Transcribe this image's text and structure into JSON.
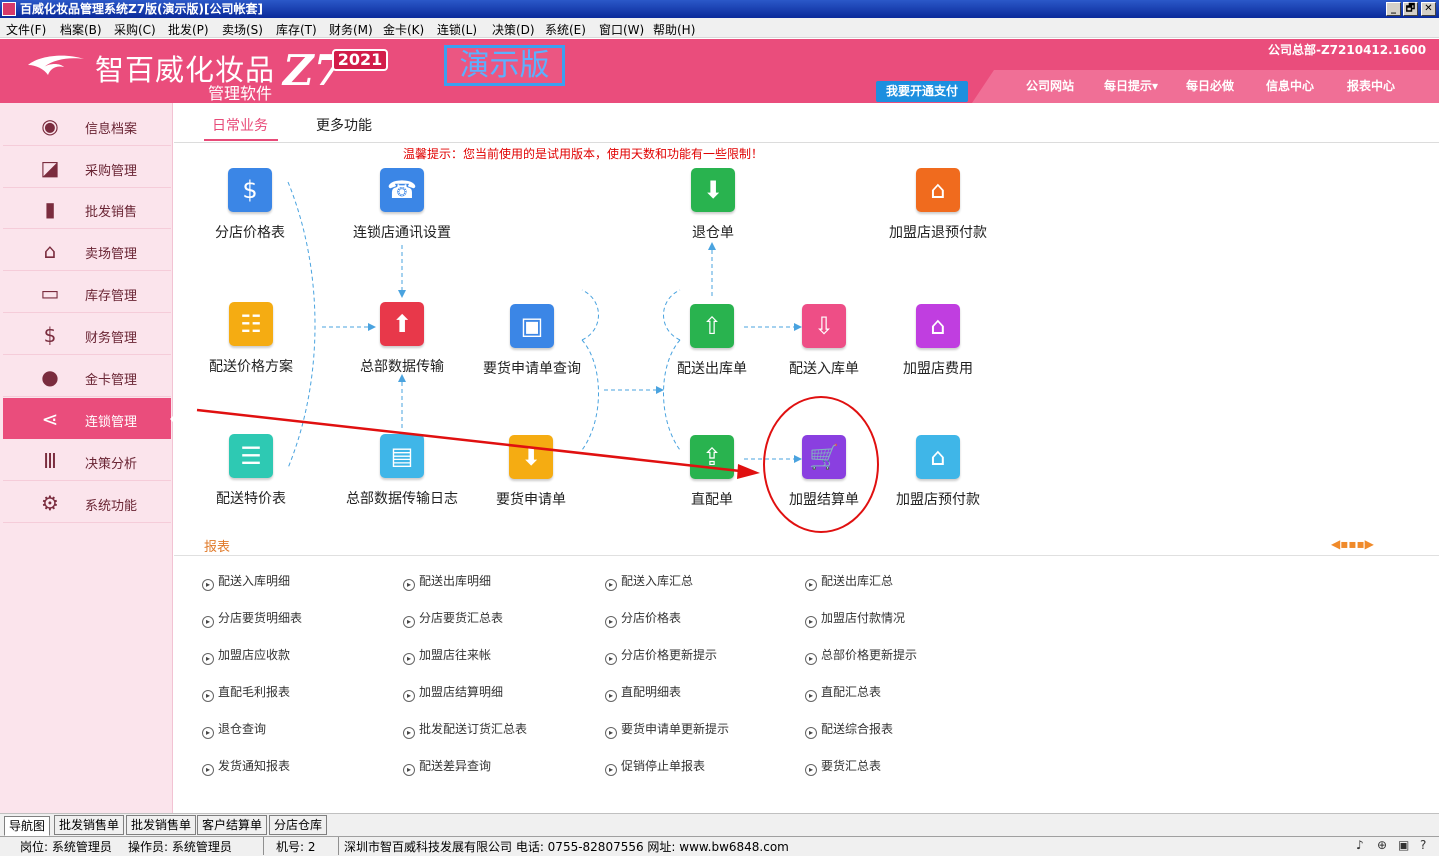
{
  "window": {
    "title": "百威化妆品管理系统Z7版(演示版)[公司帐套]",
    "controls": [
      "_",
      "🗗",
      "✕"
    ]
  },
  "menu": [
    "文件(F)",
    "档案(B)",
    "采购(C)",
    "批发(P)",
    "卖场(S)",
    "库存(T)",
    "财务(M)",
    "金卡(K)",
    "连锁(L)",
    "决策(D)",
    "系统(E)",
    "窗口(W)",
    "帮助(H)"
  ],
  "header": {
    "brand_name": "智百威化妆品",
    "brand_sub": "管理软件",
    "brand_z7": "Z7",
    "brand_year": "2021",
    "demo_badge": "演示版",
    "company_info": "公司总部-Z7210412.1600",
    "pay_button": "我要开通支付",
    "nav": [
      "公司网站",
      "每日提示▾",
      "每日必做",
      "信息中心",
      "报表中心"
    ],
    "accent_color": "#ea4d7c"
  },
  "sidebar": {
    "items": [
      {
        "label": "信息档案",
        "icon": "user-circle-icon"
      },
      {
        "label": "采购管理",
        "icon": "chart-area-icon"
      },
      {
        "label": "批发销售",
        "icon": "bar-chart-icon"
      },
      {
        "label": "卖场管理",
        "icon": "store-icon"
      },
      {
        "label": "库存管理",
        "icon": "inbox-icon"
      },
      {
        "label": "财务管理",
        "icon": "dollar-circle-icon"
      },
      {
        "label": "金卡管理",
        "icon": "user-card-icon"
      },
      {
        "label": "连锁管理",
        "icon": "share-icon",
        "active": true
      },
      {
        "label": "决策分析",
        "icon": "columns-icon"
      },
      {
        "label": "系统功能",
        "icon": "gear-icon"
      }
    ]
  },
  "tabs": {
    "daily": "日常业务",
    "more": "更多功能"
  },
  "warning": "温馨提示：您当前使用的是试用版本，使用天数和功能有一些限制！",
  "tiles": {
    "branch_price_table": "分店价格表",
    "chain_comm_settings": "连锁店通讯设置",
    "return_warehouse": "退仓单",
    "franchise_refund_prepay": "加盟店退预付款",
    "delivery_price_plan": "配送价格方案",
    "hq_data_transfer": "总部数据传输",
    "order_request_query": "要货申请单查询",
    "delivery_out": "配送出库单",
    "delivery_in": "配送入库单",
    "franchise_fee": "加盟店费用",
    "delivery_special_price": "配送特价表",
    "hq_transfer_log": "总部数据传输日志",
    "order_request": "要货申请单",
    "direct_delivery": "直配单",
    "franchise_settlement": "加盟结算单",
    "franchise_prepay": "加盟店预付款"
  },
  "reports": {
    "heading": "报表",
    "pager": "◀▪▪▪▶",
    "items": [
      "配送入库明细",
      "配送出库明细",
      "配送入库汇总",
      "配送出库汇总",
      "分店要货明细表",
      "分店要货汇总表",
      "分店价格表",
      "加盟店付款情况",
      "加盟店应收款",
      "加盟店往来帐",
      "分店价格更新提示",
      "总部价格更新提示",
      "直配毛利报表",
      "加盟店结算明细",
      "直配明细表",
      "直配汇总表",
      "退仓查询",
      "批发配送订货汇总表",
      "要货申请单更新提示",
      "配送综合报表",
      "发货通知报表",
      "配送差异查询",
      "促销停止单报表",
      "要货汇总表"
    ]
  },
  "bottom_tabs": [
    "导航图",
    "批发销售单",
    "批发销售单",
    "客户结算单",
    "分店仓库"
  ],
  "status": {
    "post": "岗位: 系统管理员",
    "operator": "操作员: 系统管理员",
    "machine": "机号: 2",
    "company": "深圳市智百威科技发展有限公司 电话: 0755-82807556 网址: www.bw6848.com"
  }
}
